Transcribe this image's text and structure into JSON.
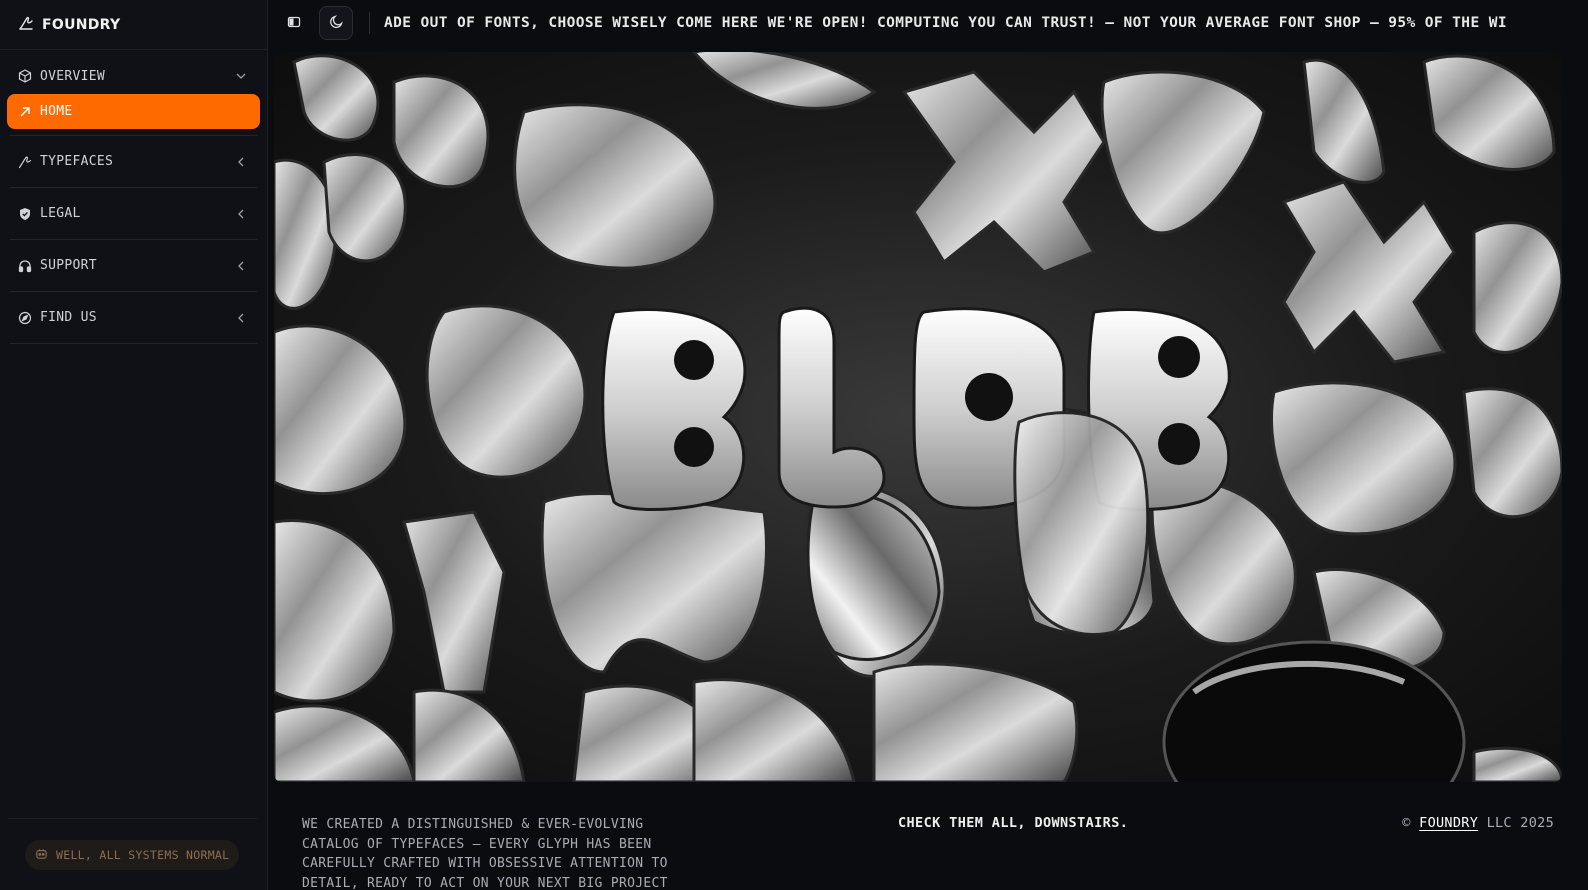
{
  "brand": {
    "name": "FOUNDRY"
  },
  "sidebar": {
    "groups": [
      {
        "label": "OVERVIEW",
        "icon": "cube-icon",
        "expanded": true,
        "items": [
          {
            "label": "HOME",
            "icon": "arrow-up-right-icon",
            "active": true
          }
        ]
      },
      {
        "label": "TYPEFACES",
        "icon": "signature-icon",
        "expanded": false
      },
      {
        "label": "LEGAL",
        "icon": "shield-icon",
        "expanded": false
      },
      {
        "label": "SUPPORT",
        "icon": "headphones-icon",
        "expanded": false
      },
      {
        "label": "FIND US",
        "icon": "compass-icon",
        "expanded": false
      }
    ],
    "status": "WELL, ALL SYSTEMS NORMAL"
  },
  "topbar": {
    "marquee": "ADE OUT OF FONTS, CHOOSE WISELY  COME HERE WE'RE OPEN! COMPUTING YOU CAN TRUST! — NOT YOUR AVERAGE FONT SHOP — 95% OF THE WI"
  },
  "hero": {
    "headline": "BLOB"
  },
  "footer": {
    "description": "WE CREATED A DISTINGUISHED & EVER-EVOLVING CATALOG OF TYPEFACES — EVERY GLYPH HAS BEEN CAREFULLY CRAFTED WITH OBSESSIVE ATTENTION TO DETAIL, READY TO ACT ON YOUR NEXT BIG PROJECT",
    "cta": "CHECK THEM ALL, DOWNSTAIRS.",
    "copyright_symbol": "©",
    "copyright_brand": "FOUNDRY",
    "copyright_rest": "LLC 2025"
  },
  "colors": {
    "accent": "#ff6a00",
    "background": "#0b0c10",
    "sidebar": "#0f1116"
  }
}
